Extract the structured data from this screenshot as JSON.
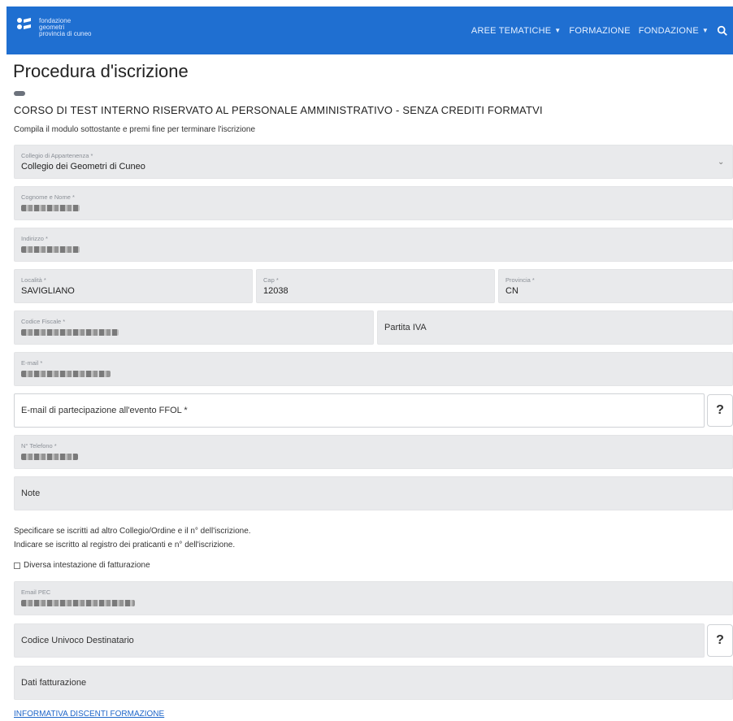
{
  "header": {
    "logo_text": [
      "fondazione",
      "geometri",
      "provincia di cuneo"
    ],
    "nav": [
      {
        "label": "AREE TEMATICHE",
        "has_caret": true
      },
      {
        "label": "FORMAZIONE",
        "has_caret": false
      },
      {
        "label": "FONDAZIONE",
        "has_caret": true
      }
    ],
    "search_icon": "search-icon",
    "bar_color": "#1f6fd1"
  },
  "page": {
    "title": "Procedura d'iscrizione",
    "course_title": "CORSO DI TEST INTERNO RISERVATO AL PERSONALE AMMINISTRATIVO - SENZA CREDITI FORMATVI",
    "instructions": "Compila il modulo sottostante e premi fine per terminare l'iscrizione"
  },
  "form": {
    "collegio": {
      "label": "Collegio di Appartenenza *",
      "value": "Collegio dei Geometri di Cuneo"
    },
    "cognome_nome": {
      "label": "Cognome e Nome *"
    },
    "indirizzo": {
      "label": "Indirizzo *"
    },
    "localita": {
      "label": "Località *",
      "value": "SAVIGLIANO"
    },
    "cap": {
      "label": "Cap *",
      "value": "12038"
    },
    "provincia": {
      "label": "Provincia *",
      "value": "CN"
    },
    "codice_fiscale": {
      "label": "Codice Fiscale *"
    },
    "partita_iva": {
      "placeholder": "Partita IVA"
    },
    "email": {
      "label": "E-mail *"
    },
    "email_partecipazione": {
      "placeholder": "E-mail di partecipazione all'evento FFOL *"
    },
    "telefono": {
      "label": "N° Telefono *"
    },
    "note": {
      "placeholder": "Note"
    },
    "note_help": [
      "Specificare se iscritti ad altro Collegio/Ordine e il n° dell'iscrizione.",
      "Indicare se iscritto al registro dei praticanti e n° dell'iscrizione."
    ],
    "diversa_fatturazione": {
      "label": "Diversa intestazione di fatturazione"
    },
    "email_pec": {
      "label": "Email PEC"
    },
    "codice_univoco": {
      "placeholder": "Codice Univoco Destinatario"
    },
    "dati_fatturazione": {
      "placeholder": "Dati fatturazione"
    },
    "help_label": "?"
  },
  "footer": {
    "informativa_link": "INFORMATIVA DISCENTI FORMAZIONE"
  }
}
